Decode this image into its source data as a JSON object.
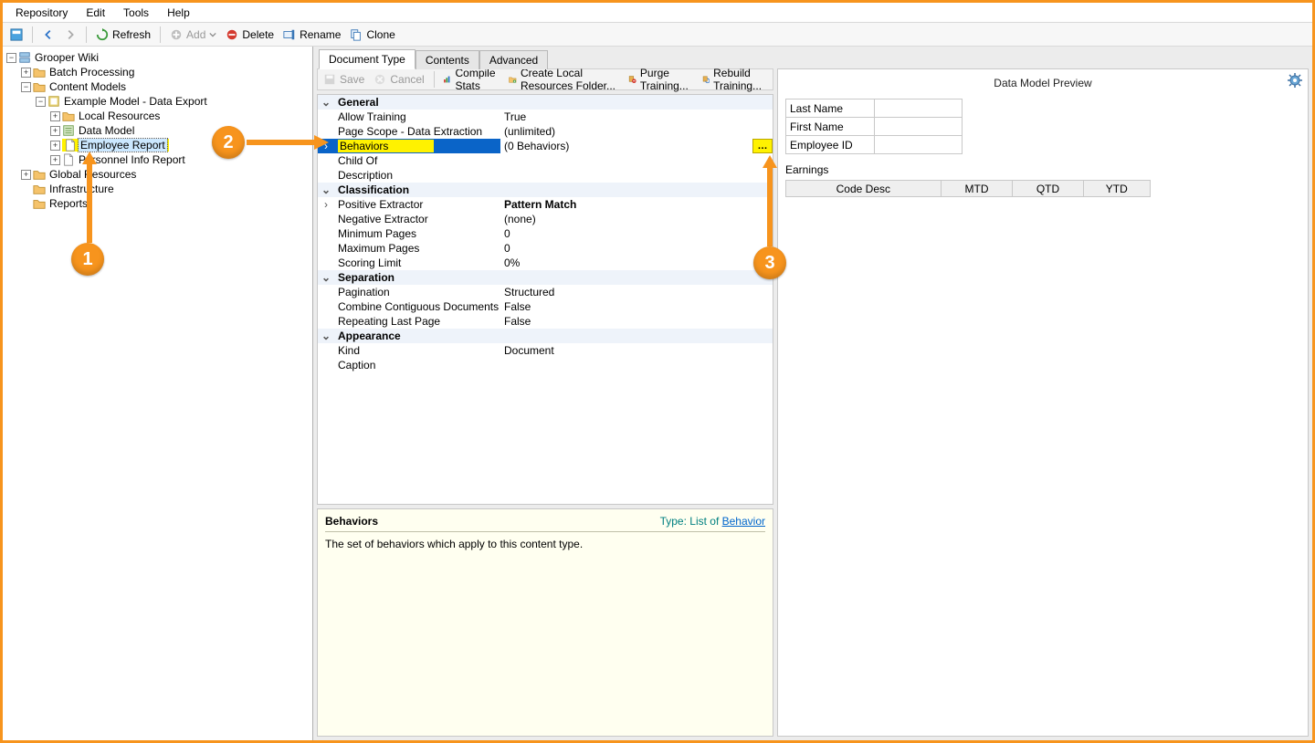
{
  "menubar": [
    "Repository",
    "Edit",
    "Tools",
    "Help"
  ],
  "toolbar": {
    "refresh": "Refresh",
    "add": "Add",
    "delete": "Delete",
    "rename": "Rename",
    "clone": "Clone"
  },
  "tree": {
    "root": "Grooper Wiki",
    "batch_processing": "Batch Processing",
    "content_models": "Content Models",
    "example_model": "Example Model - Data Export",
    "local_resources": "Local Resources",
    "data_model": "Data Model",
    "employee_report": "Employee Report",
    "personnel_info": "Personnel Info Report",
    "global_resources": "Global Resources",
    "infrastructure": "Infrastructure",
    "reports": "Reports"
  },
  "tabs": {
    "doc_type": "Document Type",
    "contents": "Contents",
    "advanced": "Advanced"
  },
  "prop_toolbar": {
    "save": "Save",
    "cancel": "Cancel",
    "compile": "Compile Stats",
    "create_local": "Create Local Resources Folder...",
    "purge": "Purge Training...",
    "rebuild": "Rebuild Training..."
  },
  "props": {
    "sections": {
      "general": "General",
      "classification": "Classification",
      "separation": "Separation",
      "appearance": "Appearance"
    },
    "general": {
      "allow_training_l": "Allow Training",
      "allow_training_v": "True",
      "page_scope_l": "Page Scope - Data Extraction",
      "page_scope_v": "(unlimited)",
      "behaviors_l": "Behaviors",
      "behaviors_v": "(0 Behaviors)",
      "child_of_l": "Child Of",
      "child_of_v": "",
      "description_l": "Description",
      "description_v": ""
    },
    "classification": {
      "pos_ext_l": "Positive Extractor",
      "pos_ext_v": "Pattern Match",
      "neg_ext_l": "Negative Extractor",
      "neg_ext_v": "(none)",
      "min_pages_l": "Minimum Pages",
      "min_pages_v": "0",
      "max_pages_l": "Maximum Pages",
      "max_pages_v": "0",
      "scoring_l": "Scoring Limit",
      "scoring_v": "0%"
    },
    "separation": {
      "pagination_l": "Pagination",
      "pagination_v": "Structured",
      "combine_l": "Combine Contiguous Documents",
      "combine_v": "False",
      "repeating_l": "Repeating Last Page",
      "repeating_v": "False"
    },
    "appearance": {
      "kind_l": "Kind",
      "kind_v": "Document",
      "caption_l": "Caption",
      "caption_v": ""
    }
  },
  "help": {
    "title": "Behaviors",
    "type_prefix": "Type: ",
    "type_text": "List of ",
    "type_link": "Behavior",
    "body": "The set of behaviors which apply to this content type."
  },
  "preview": {
    "title": "Data Model Preview",
    "fields": {
      "last_name": "Last Name",
      "first_name": "First Name",
      "emp_id": "Employee ID"
    },
    "earnings_label": "Earnings",
    "earnings_cols": [
      "Code Desc",
      "MTD",
      "QTD",
      "YTD"
    ]
  },
  "callouts": {
    "one": "1",
    "two": "2",
    "three": "3"
  }
}
